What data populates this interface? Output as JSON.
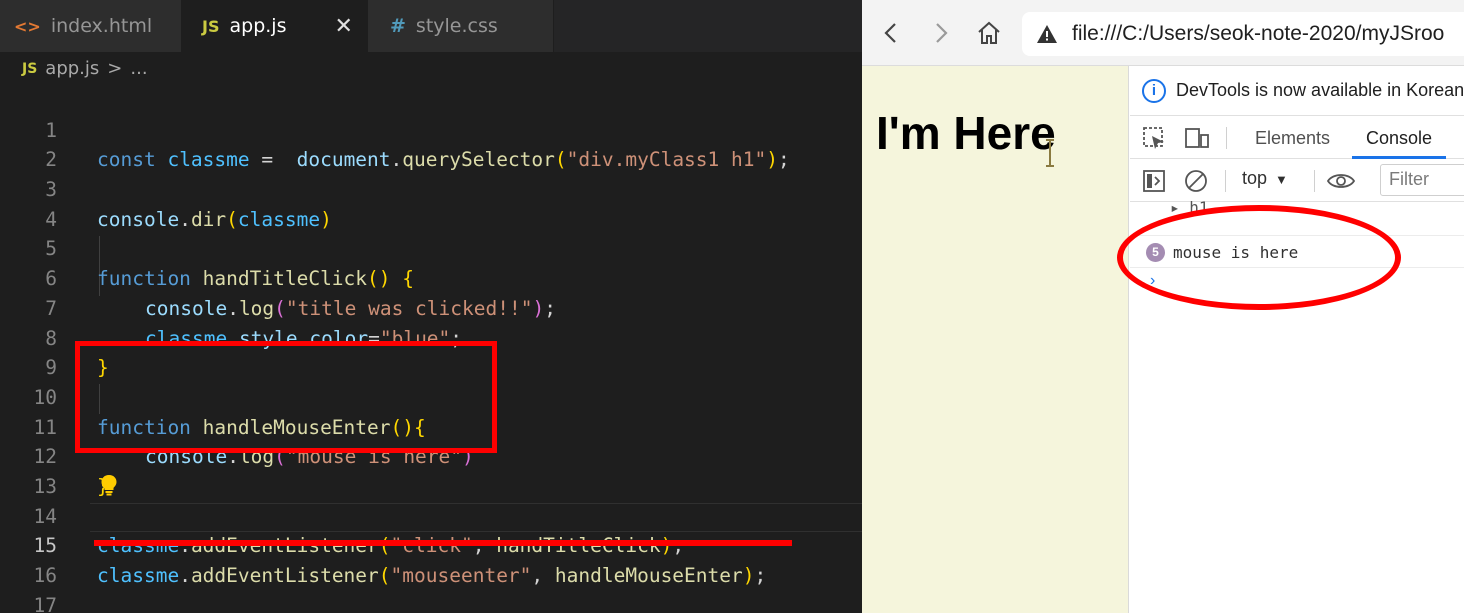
{
  "editor": {
    "tabs": [
      {
        "label": "index.html",
        "icon": "<>"
      },
      {
        "label": "app.js",
        "icon": "JS",
        "close": "✕"
      },
      {
        "label": "style.css",
        "icon": "#"
      }
    ],
    "breadcrumb": {
      "icon": "JS",
      "file": "app.js",
      "sep": ">",
      "rest": "..."
    },
    "line_numbers": [
      "1",
      "2",
      "3",
      "4",
      "5",
      "6",
      "7",
      "8",
      "9",
      "10",
      "11",
      "12",
      "13",
      "14",
      "15",
      "16",
      "17"
    ],
    "current_line": 15,
    "code": {
      "l1": {
        "kw": "const",
        "var": "classme",
        "eq": " =  ",
        "obj": "document",
        "dot": ".",
        "fn": "querySelector",
        "open": "(",
        "str": "\"div.myClass1 h1\"",
        "close": ")",
        "end": ";"
      },
      "l3": {
        "obj": "console",
        "dot": ".",
        "fn": "dir",
        "open": "(",
        "arg": "classme",
        "close": ")"
      },
      "l5": {
        "kw": "function",
        "fn": "handTitleClick",
        "parens": "()",
        "brace": " {"
      },
      "l6": {
        "obj": "console",
        "dot": ".",
        "fn": "log",
        "open": "(",
        "str": "\"title was clicked!!\"",
        "close": ")",
        "end": ";"
      },
      "l7": {
        "var": "classme",
        "dot1": ".",
        "prop1": "style",
        "dot2": ".",
        "prop2": "color",
        "eq": "=",
        "str": "\"blue\"",
        "end": ";"
      },
      "l8": {
        "brace": "}"
      },
      "l10": {
        "kw": "function",
        "fn": "handleMouseEnter",
        "parens": "()",
        "brace": "{"
      },
      "l11": {
        "obj": "console",
        "dot": ".",
        "fn": "log",
        "open": "(",
        "str": "\"mouse is here\"",
        "close": ")"
      },
      "l12": {
        "brace": "}"
      },
      "l14": {
        "var": "classme",
        "dot": ".",
        "fn": "addEventListener",
        "open": "(",
        "str": "\"click\"",
        "comma": ", ",
        "arg": "handTitleClick",
        "close": ")",
        "end": ";"
      },
      "l15": {
        "var": "classme",
        "dot": ".",
        "fn": "addEventListener",
        "open": "(",
        "str": "\"mouseenter\"",
        "comma": ", ",
        "arg": "handleMouseEnter",
        "close": ")",
        "end": ";"
      }
    }
  },
  "browser": {
    "url": "file:///C:/Users/seok-note-2020/myJSroo",
    "page_heading": "I'm Here",
    "devtools": {
      "info_icon": "i",
      "info_text": "DevTools is now available in Korean",
      "tabs": [
        "Elements",
        "Console"
      ],
      "active_tab": "Console",
      "context": "top",
      "context_caret": "▼",
      "filter_placeholder": "Filter",
      "console_rows": [
        {
          "text": "▸ h1"
        },
        {
          "count": "5",
          "text": "mouse is here"
        }
      ],
      "prompt": "›"
    }
  },
  "colors": {
    "annotation": "#ff0000",
    "editor_bg": "#1e1e1e",
    "page_bg": "#f5f5dc",
    "accent": "#1a73e8"
  }
}
